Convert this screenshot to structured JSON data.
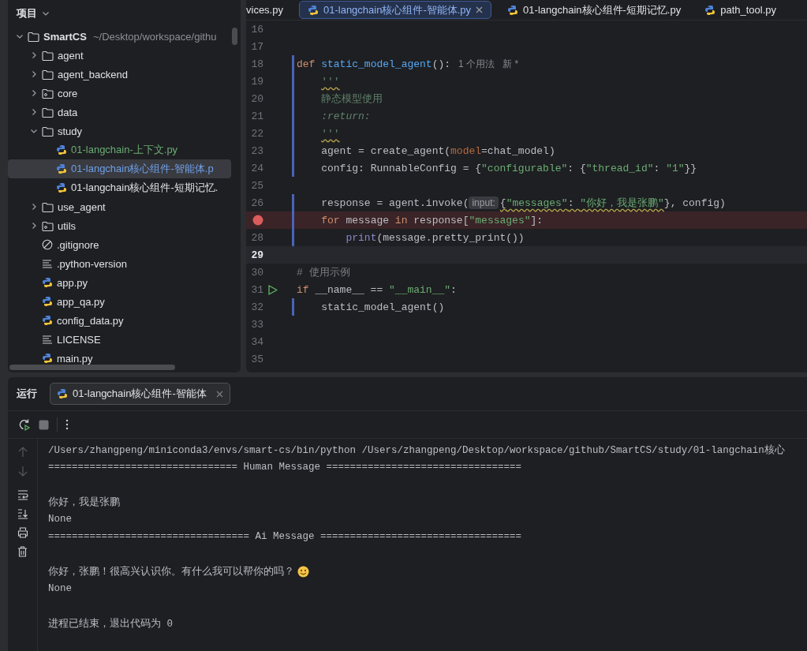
{
  "project_panel": {
    "title": "项目",
    "tree": [
      {
        "name": "SmartCS",
        "path": "~/Desktop/workspace/githu",
        "kind": "folder",
        "expanded": true,
        "selected": false,
        "color": "#dfe1e5",
        "children": [
          {
            "name": "agent",
            "kind": "folder",
            "expanded": false,
            "selected": false,
            "color": "#dfe1e5"
          },
          {
            "name": "agent_backend",
            "kind": "folder",
            "expanded": false,
            "selected": false,
            "color": "#dfe1e5"
          },
          {
            "name": "core",
            "kind": "source_folder",
            "expanded": false,
            "selected": false,
            "color": "#dfe1e5"
          },
          {
            "name": "data",
            "kind": "folder",
            "expanded": false,
            "selected": false,
            "color": "#dfe1e5"
          },
          {
            "name": "study",
            "kind": "folder",
            "expanded": true,
            "selected": false,
            "color": "#dfe1e5",
            "children": [
              {
                "name": "01-langchain-上下文.py",
                "kind": "python",
                "selected": false,
                "color": "#6aab73"
              },
              {
                "name": "01-langchain核心组件-智能体.p",
                "kind": "python",
                "selected": true,
                "color": "#6f9fe8"
              },
              {
                "name": "01-langchain核心组件-短期记忆.",
                "kind": "python",
                "selected": false,
                "color": "#dfe1e5"
              }
            ]
          },
          {
            "name": "use_agent",
            "kind": "folder",
            "expanded": false,
            "selected": false,
            "color": "#dfe1e5"
          },
          {
            "name": "utils",
            "kind": "source_folder",
            "expanded": false,
            "selected": false,
            "color": "#dfe1e5"
          },
          {
            "name": ".gitignore",
            "kind": "ignore",
            "selected": false,
            "color": "#dfe1e5"
          },
          {
            "name": ".python-version",
            "kind": "text",
            "selected": false,
            "color": "#dfe1e5"
          },
          {
            "name": "app.py",
            "kind": "python",
            "selected": false,
            "color": "#dfe1e5"
          },
          {
            "name": "app_qa.py",
            "kind": "python",
            "selected": false,
            "color": "#dfe1e5"
          },
          {
            "name": "config_data.py",
            "kind": "python",
            "selected": false,
            "color": "#dfe1e5"
          },
          {
            "name": "LICENSE",
            "kind": "text",
            "selected": false,
            "color": "#dfe1e5"
          },
          {
            "name": "main.py",
            "kind": "python",
            "selected": false,
            "color": "#dfe1e5"
          }
        ]
      }
    ]
  },
  "editor": {
    "tabs": [
      {
        "label": "vices.py",
        "kind": "cut",
        "selected": false
      },
      {
        "label": "01-langchain核心组件-智能体.py",
        "kind": "python",
        "selected": true
      },
      {
        "label": "01-langchain核心组件-短期记忆.py",
        "kind": "python",
        "selected": false
      },
      {
        "label": "path_tool.py",
        "kind": "python",
        "selected": false
      }
    ],
    "lines": [
      {
        "number": "16",
        "changed": false,
        "breakpoint": false,
        "run": false,
        "current": false
      },
      {
        "number": "17",
        "changed": false,
        "breakpoint": false,
        "run": false,
        "current": false
      },
      {
        "number": "18",
        "changed": true,
        "breakpoint": false,
        "run": false,
        "current": false,
        "tokens": [
          {
            "kind": "kw",
            "text": "def "
          },
          {
            "kind": "fn",
            "text": "static_model_agent"
          },
          {
            "kind": "plain",
            "text": "():"
          },
          {
            "kind": "usage",
            "text": "1 个用法"
          },
          {
            "kind": "usage",
            "text": "新 *"
          }
        ]
      },
      {
        "number": "19",
        "changed": true,
        "breakpoint": false,
        "run": false,
        "current": false,
        "tokens": [
          {
            "kind": "doc_warn",
            "text": "    '''"
          }
        ]
      },
      {
        "number": "20",
        "changed": true,
        "breakpoint": false,
        "run": false,
        "current": false,
        "tokens": [
          {
            "kind": "doc",
            "text": "    静态模型使用"
          }
        ]
      },
      {
        "number": "21",
        "changed": true,
        "breakpoint": false,
        "run": false,
        "current": false,
        "tokens": [
          {
            "kind": "doc_tag",
            "text": "    :return:"
          }
        ]
      },
      {
        "number": "22",
        "changed": true,
        "breakpoint": false,
        "run": false,
        "current": false,
        "tokens": [
          {
            "kind": "doc_warn",
            "text": "    '''"
          }
        ]
      },
      {
        "number": "23",
        "changed": true,
        "breakpoint": false,
        "run": false,
        "current": false,
        "tokens": [
          {
            "kind": "plain",
            "text": "    agent = create_agent("
          },
          {
            "kind": "param",
            "text": "model"
          },
          {
            "kind": "plain",
            "text": "=chat_model)"
          }
        ]
      },
      {
        "number": "24",
        "changed": true,
        "breakpoint": false,
        "run": false,
        "current": false,
        "tokens": [
          {
            "kind": "plain",
            "text": "    config: RunnableConfig = {"
          },
          {
            "kind": "str",
            "text": "\"configurable\""
          },
          {
            "kind": "plain",
            "text": ": {"
          },
          {
            "kind": "str",
            "text": "\"thread_id\""
          },
          {
            "kind": "plain",
            "text": ": "
          },
          {
            "kind": "str",
            "text": "\"1\""
          },
          {
            "kind": "plain",
            "text": "}}"
          }
        ]
      },
      {
        "number": "25",
        "changed": false,
        "breakpoint": false,
        "run": false,
        "current": false
      },
      {
        "number": "26",
        "changed": true,
        "breakpoint": false,
        "run": false,
        "current": false,
        "tokens": [
          {
            "kind": "plain",
            "text": "    response = agent.invoke("
          },
          {
            "kind": "inlay",
            "text": "input:"
          },
          {
            "kind": "plain_warn",
            "text": "{"
          },
          {
            "kind": "str_warn",
            "text": "\"messages\""
          },
          {
            "kind": "plain_warn",
            "text": ": "
          },
          {
            "kind": "str_warn",
            "text": "\"你好，我是张鹏\""
          },
          {
            "kind": "plain",
            "text": "}, config)"
          }
        ]
      },
      {
        "changed": true,
        "breakpoint": true,
        "run": false,
        "current": false,
        "tokens": [
          {
            "kind": "kw",
            "text": "    for "
          },
          {
            "kind": "plain",
            "text": "message "
          },
          {
            "kind": "kw",
            "text": "in "
          },
          {
            "kind": "plain",
            "text": "response["
          },
          {
            "kind": "str",
            "text": "\"messages\""
          },
          {
            "kind": "plain",
            "text": "]:"
          }
        ]
      },
      {
        "number": "28",
        "changed": true,
        "breakpoint": false,
        "run": false,
        "current": false,
        "tokens": [
          {
            "kind": "builtin",
            "text": "        print"
          },
          {
            "kind": "plain",
            "text": "(message.pretty_print())"
          }
        ]
      },
      {
        "number": "29",
        "changed": false,
        "breakpoint": false,
        "run": false,
        "current": true
      },
      {
        "number": "30",
        "changed": false,
        "breakpoint": false,
        "run": false,
        "current": false,
        "tokens": [
          {
            "kind": "comment",
            "text": "# 使用示例"
          }
        ]
      },
      {
        "number": "31",
        "changed": false,
        "breakpoint": false,
        "run": true,
        "current": false,
        "tokens": [
          {
            "kind": "kw",
            "text": "if "
          },
          {
            "kind": "plain",
            "text": "__name__ == "
          },
          {
            "kind": "str",
            "text": "\"__main__\""
          },
          {
            "kind": "plain",
            "text": ":"
          }
        ]
      },
      {
        "number": "32",
        "changed": true,
        "breakpoint": false,
        "run": false,
        "current": false,
        "tokens": [
          {
            "kind": "plain",
            "text": "    static_model_agent()"
          }
        ]
      },
      {
        "number": "33",
        "changed": false,
        "breakpoint": false,
        "run": false,
        "current": false
      },
      {
        "number": "34",
        "changed": false,
        "breakpoint": false,
        "run": false,
        "current": false
      },
      {
        "number": "35",
        "changed": false,
        "breakpoint": false,
        "run": false,
        "current": false
      }
    ]
  },
  "run_panel": {
    "title": "运行",
    "tabs": [
      {
        "label": "01-langchain核心组件-智能体",
        "selected": true
      }
    ],
    "console": [
      {
        "kind": "text",
        "text": "/Users/zhangpeng/miniconda3/envs/smart-cs/bin/python /Users/zhangpeng/Desktop/workspace/github/SmartCS/study/01-langchain核心"
      },
      {
        "kind": "text",
        "text": "================================ Human Message ================================="
      },
      {
        "kind": "blank"
      },
      {
        "kind": "text",
        "text": "你好，我是张鹏"
      },
      {
        "kind": "text",
        "text": "None"
      },
      {
        "kind": "text",
        "text": "================================== Ai Message =================================="
      },
      {
        "kind": "blank"
      },
      {
        "kind": "text_emoji",
        "text": "你好，张鹏！很高兴认识你。有什么我可以帮你的吗？"
      },
      {
        "kind": "text",
        "text": "None"
      },
      {
        "kind": "blank"
      },
      {
        "kind": "text",
        "text": "进程已结束，退出代码为 0"
      }
    ]
  }
}
